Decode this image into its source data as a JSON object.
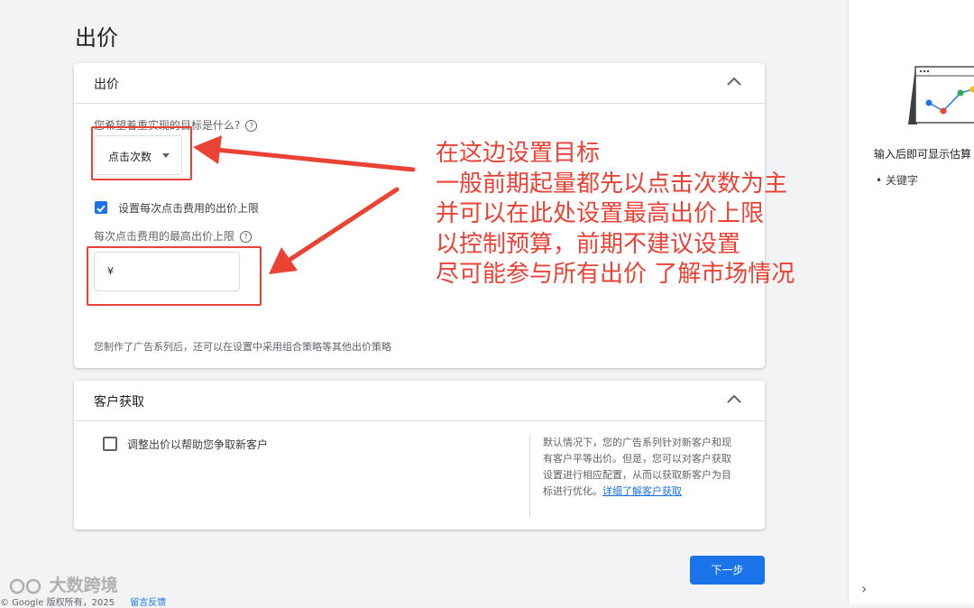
{
  "page": {
    "title": "出价"
  },
  "bidding_card": {
    "title": "出价",
    "goal_question": "您希望着重实现的目标是什么?",
    "goal_select_value": "点击次数",
    "cpc_limit_checkbox_label": "设置每次点击费用的出价上限",
    "cpc_limit_checked": true,
    "max_cpc_label": "每次点击费用的最高出价上限",
    "currency_symbol": "¥",
    "footnote": "您制作了广告系列后，还可以在设置中采用组合策略等其他出价策略"
  },
  "annotation": {
    "lines": [
      "在这边设置目标",
      "一般前期起量都先以点击次数为主",
      "并可以在此处设置最高出价上限",
      "以控制预算，前期不建议设置",
      "尽可能参与所有出价 了解市场情况"
    ],
    "color": "#ea4335"
  },
  "acquisition_card": {
    "title": "客户获取",
    "checkbox_label": "调整出价以帮助您争取新客户",
    "checked": false,
    "description": "默认情况下，您的广告系列针对新客户和现有客户平等出价。但是，您可以对客户获取设置进行相应配置，从而以获取新客户为目标进行优化。",
    "learn_more_link": "详细了解客户获取"
  },
  "next_button": {
    "label": "下一步"
  },
  "side_panel": {
    "hint": "输入后即可显示估算",
    "bullet": "关键字"
  },
  "footer": {
    "copyright": "© Google 版权所有，2025",
    "feedback_link": "留言反馈"
  },
  "watermark": "大数跨境",
  "colors": {
    "primary": "#1a73e8",
    "annotation_red": "#ea4335",
    "background": "#f1f3f4"
  }
}
